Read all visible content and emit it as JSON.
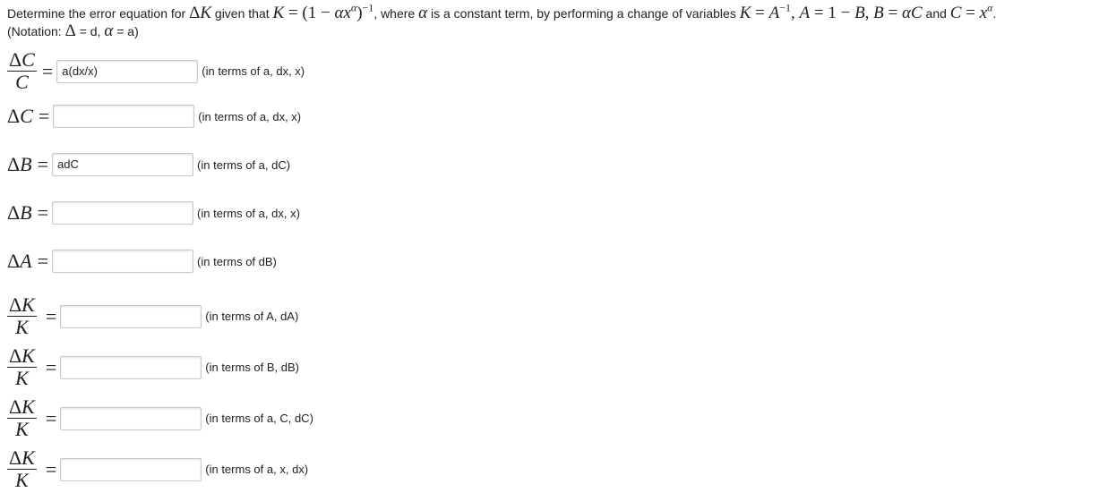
{
  "question": {
    "p1": "Determine the error equation for ",
    "p2": " given that ",
    "p3": ", where ",
    "p4": " is a constant term, by performing a change of variables ",
    "p5": " and ",
    "p6": ".",
    "notation_prefix": "(Notation: ",
    "notation_mid": " = d, ",
    "notation_suffix": " = a)"
  },
  "rows": [
    {
      "lhs": "ΔC/C",
      "value": "a(dx/x)",
      "hint": "(in terms of a, dx, x)"
    },
    {
      "lhs": "ΔC",
      "value": "",
      "hint": "(in terms of a, dx, x)"
    },
    {
      "lhs": "ΔB",
      "value": "adC",
      "hint": "(in terms of a, dC)"
    },
    {
      "lhs": "ΔB",
      "value": "",
      "hint": "(in terms of a, dx, x)"
    },
    {
      "lhs": "ΔA",
      "value": "",
      "hint": "(in terms of dB)"
    },
    {
      "lhs": "ΔK/K",
      "value": "",
      "hint": "(in terms of A, dA)"
    },
    {
      "lhs": "ΔK/K",
      "value": "",
      "hint": "(in terms of B, dB)"
    },
    {
      "lhs": "ΔK/K",
      "value": "",
      "hint": "(in terms of a, C, dC)"
    },
    {
      "lhs": "ΔK/K",
      "value": "",
      "hint": "(in terms of a, x, dx)"
    }
  ]
}
